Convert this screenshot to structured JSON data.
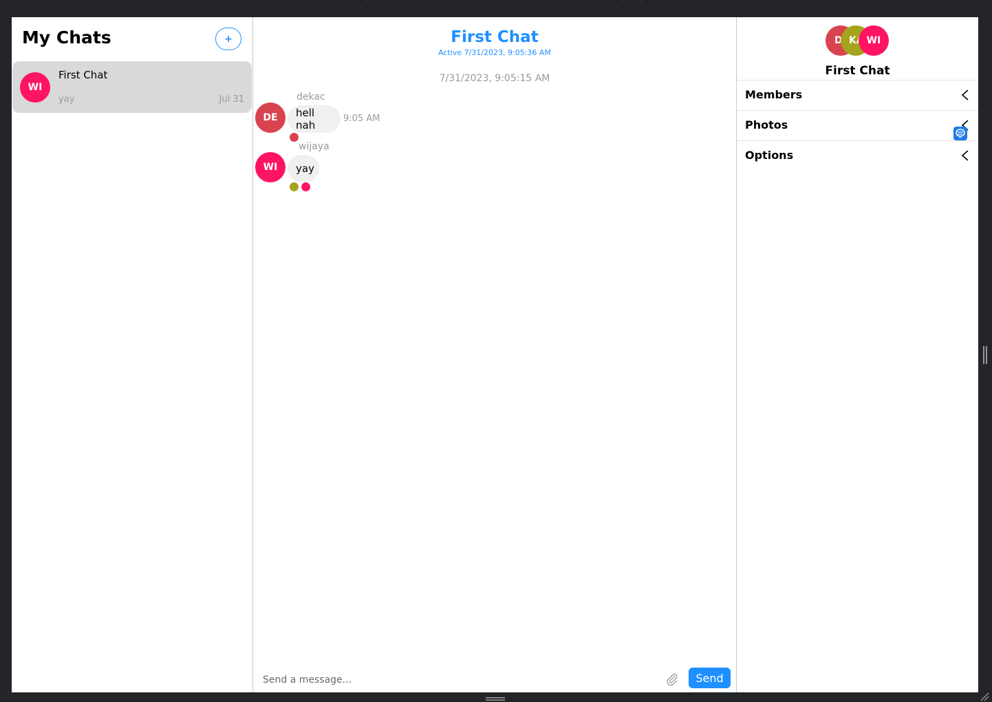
{
  "colors": {
    "accent": "#1e90ff",
    "de": "#d9434f",
    "ka": "#a4a41e",
    "wi": "#ff1462",
    "selected_bg": "#d9d9d9",
    "bubble_bg": "#f0f0f0"
  },
  "sidebar": {
    "title": "My Chats",
    "new_button": "+",
    "chats": [
      {
        "title": "First Chat",
        "avatar": "WI",
        "last_message": "yay",
        "date": "Jul 31"
      }
    ]
  },
  "chat": {
    "title": "First Chat",
    "subtitle": "Active 7/31/2023, 9:05:36 AM",
    "timestamp": "7/31/2023, 9:05:15 AM",
    "messages": [
      {
        "sender": "dekac",
        "avatar": "DE",
        "text": "hell nah",
        "time": "9:05 AM"
      },
      {
        "sender": "wijaya",
        "avatar": "WI",
        "text": "yay",
        "time": ""
      }
    ],
    "composer": {
      "placeholder": "Send a message...",
      "send_label": "Send",
      "attach_icon": "paperclip-icon"
    }
  },
  "settings": {
    "avatars": [
      "D",
      "KA",
      "WI"
    ],
    "title": "First Chat",
    "sections": [
      "Members",
      "Photos",
      "Options"
    ],
    "section_icon": "chevron-left-icon"
  }
}
